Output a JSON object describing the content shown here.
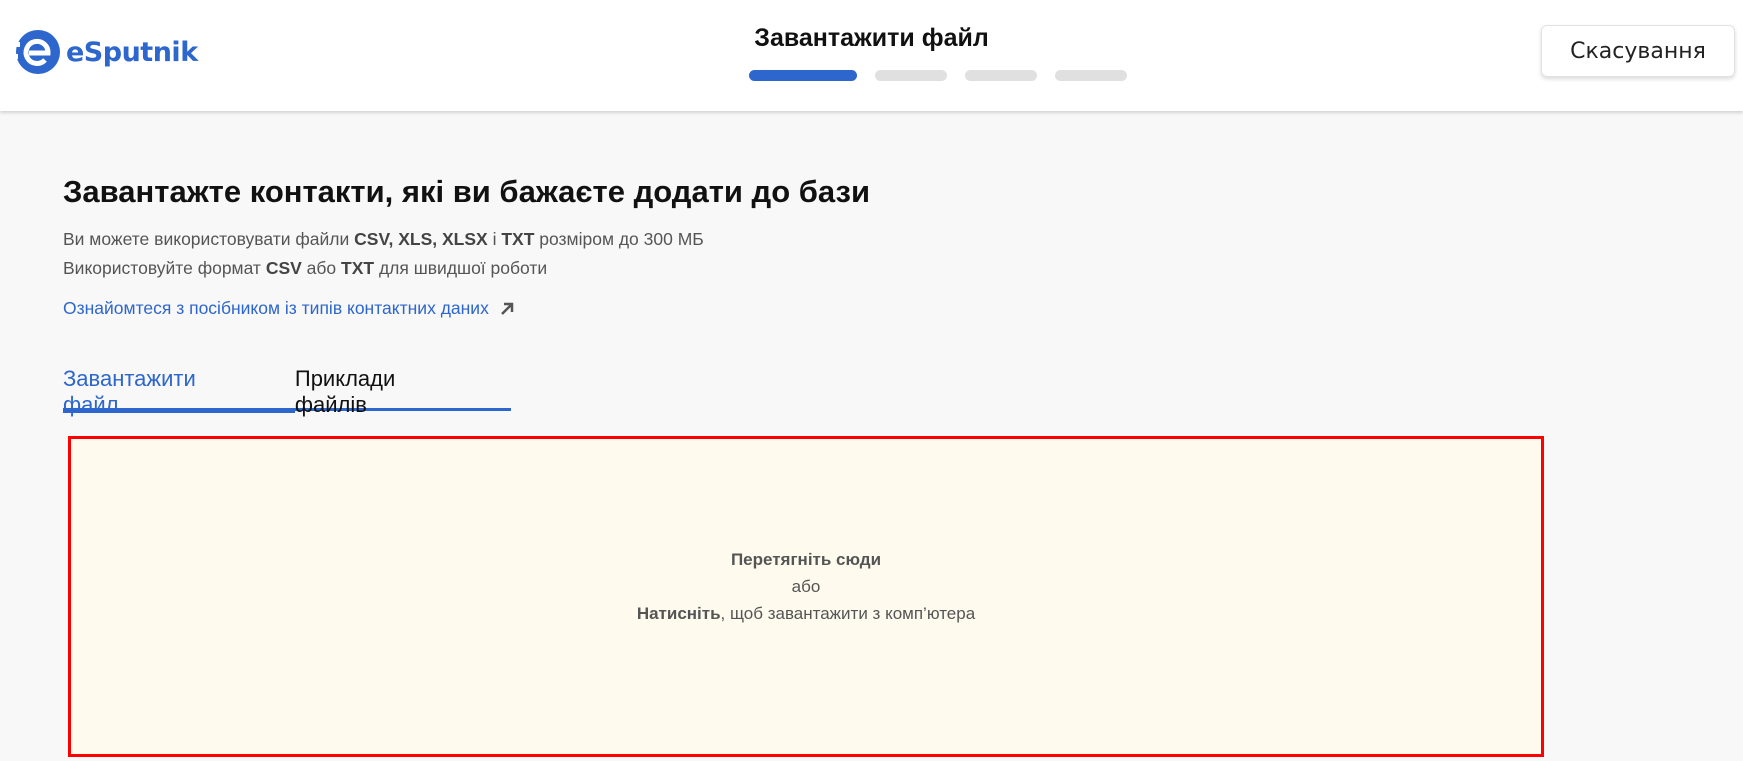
{
  "header": {
    "brand": "eSputnik",
    "step_title": "Завантажити файл",
    "steps_total": 4,
    "current_step": 1,
    "cancel_label": "Скасування"
  },
  "main": {
    "heading": "Завантажте контакти, які ви бажаєте додати до бази",
    "line1": {
      "pre": "Ви можете використовувати файли ",
      "formats": "CSV, XLS, XLSX",
      "mid": " і ",
      "fmt2": "TXT",
      "post": " розміром до 300 МБ"
    },
    "line2": {
      "pre": "Використовуйте формат ",
      "fmt1": "CSV",
      "mid": " або ",
      "fmt2": "TXT",
      "post": " для швидшої роботи"
    },
    "guide_link": "Ознайомтеся з посібником із типів контактних даних",
    "tabs": [
      {
        "label": "Завантажити файл",
        "active": true
      },
      {
        "label": "Приклади файлів",
        "active": false
      }
    ],
    "dropzone": {
      "line1": "Перетягніть сюди",
      "line2": "або",
      "line3_bold": "Натисніть",
      "line3_rest": ", щоб завантажити з комп’ютера"
    }
  },
  "colors": {
    "accent": "#2d66cc",
    "dropzone_border": "#ff0000",
    "dropzone_bg": "#fefaee"
  }
}
